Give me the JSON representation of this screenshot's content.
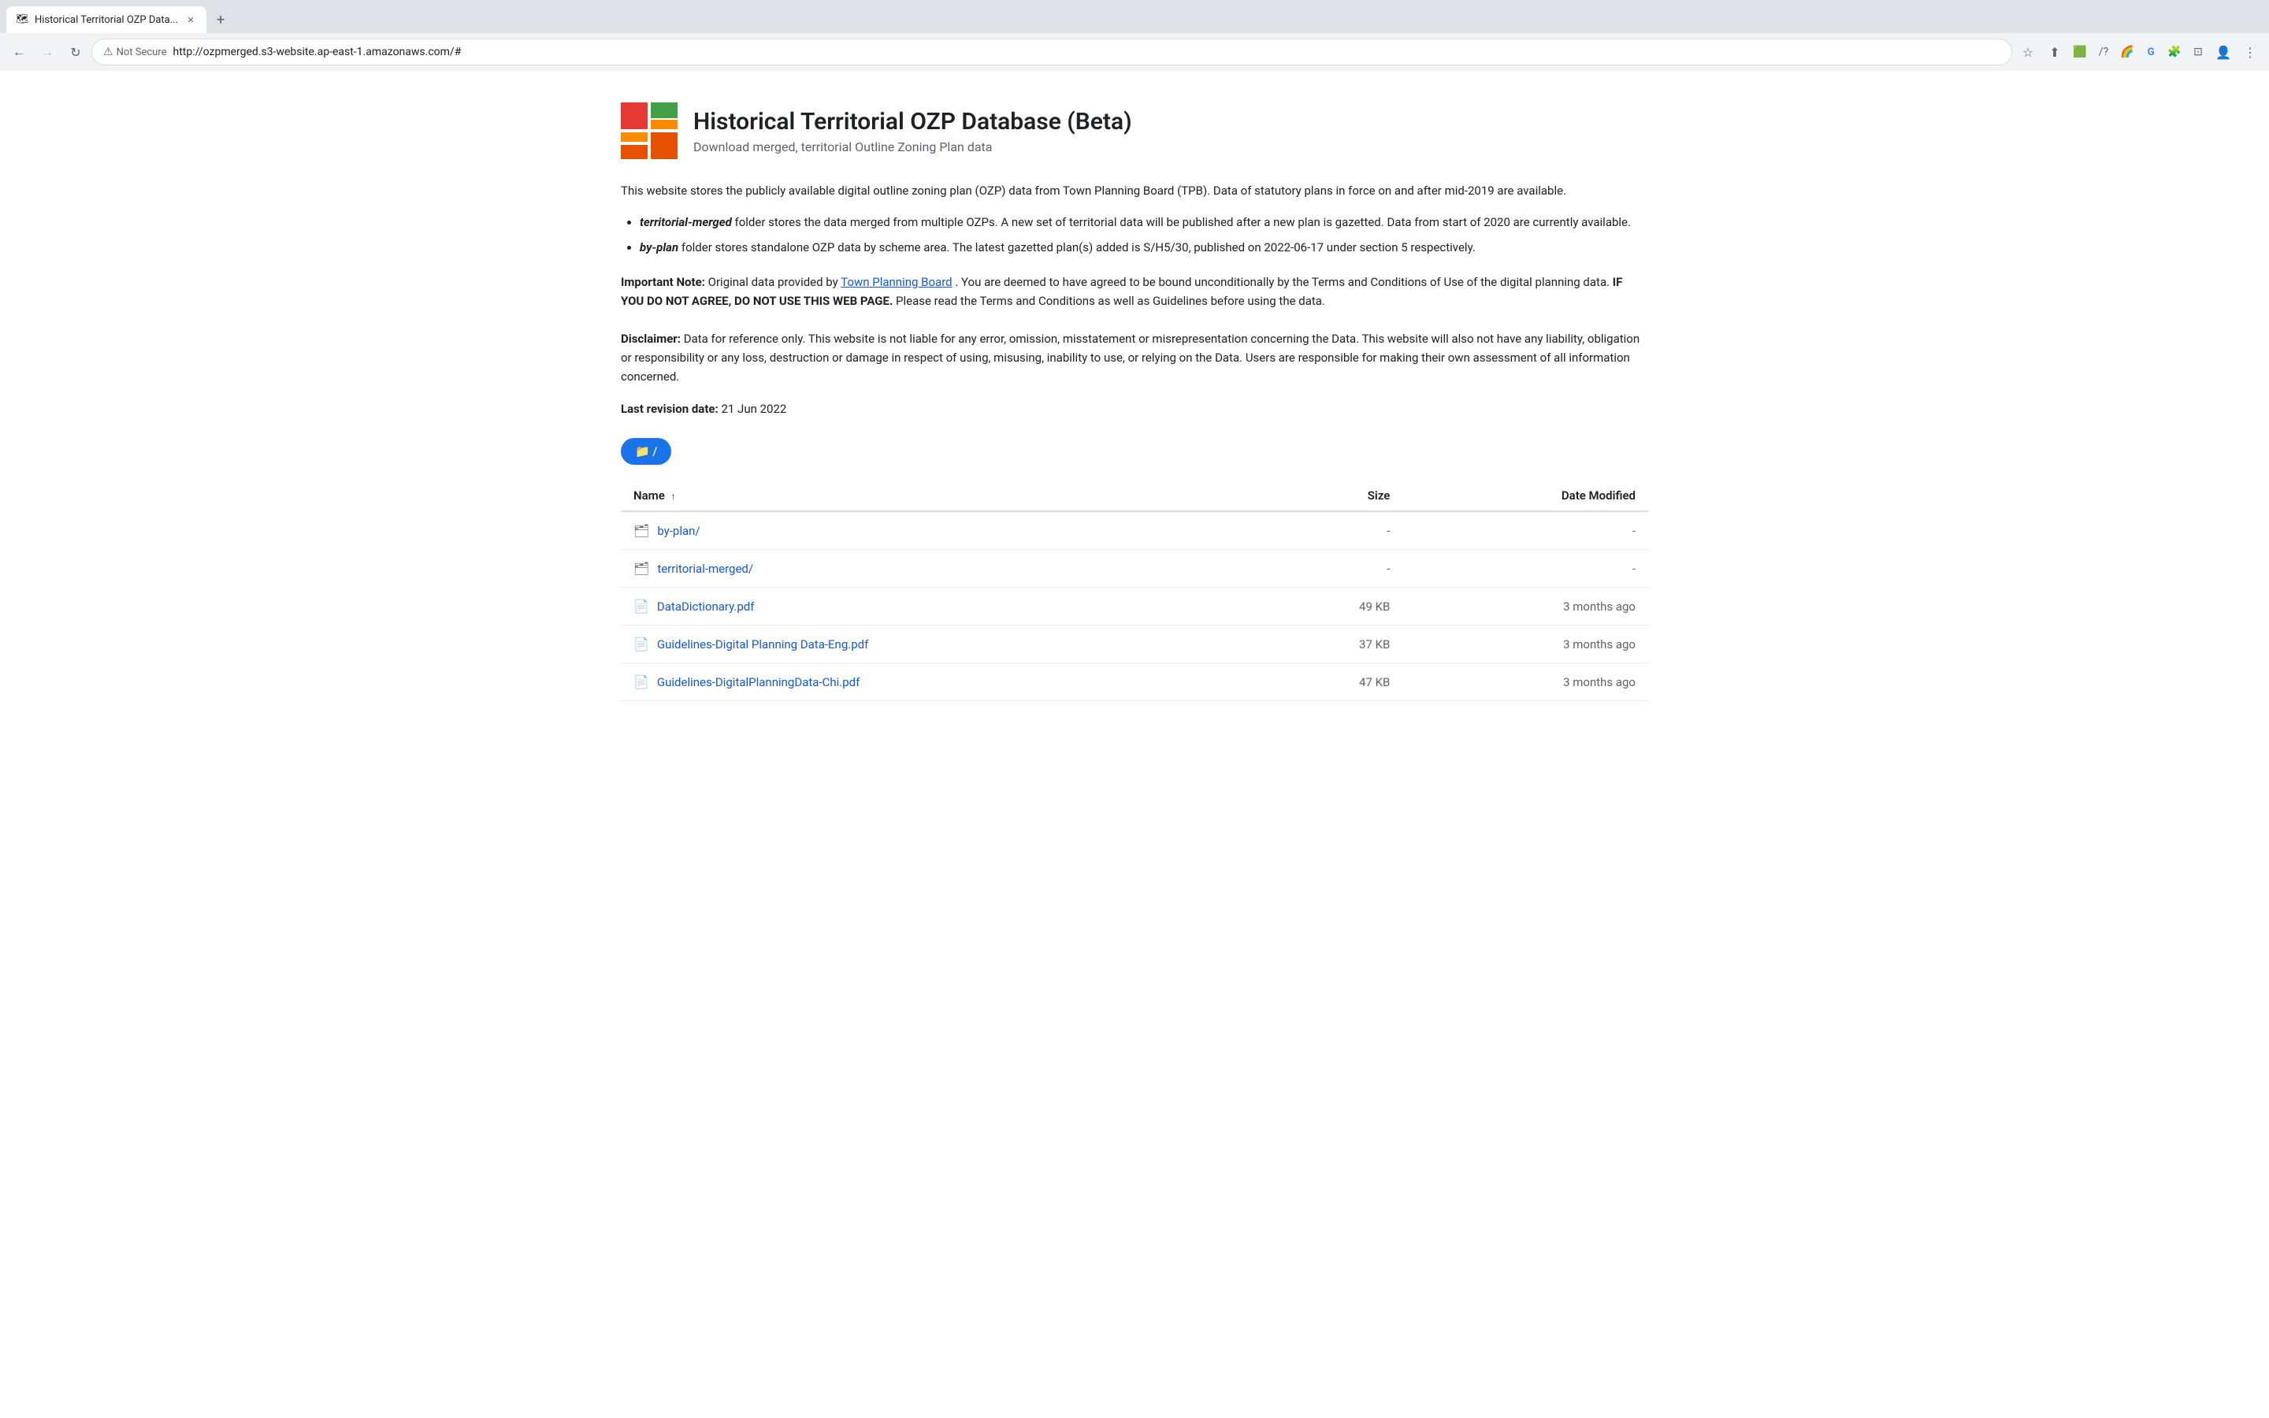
{
  "browser": {
    "tab_title": "Historical Territorial OZP Data...",
    "tab_favicon": "🗺",
    "new_tab_label": "+",
    "back_disabled": false,
    "forward_disabled": true,
    "reload_label": "↻",
    "not_secure_label": "Not Secure",
    "address_url": "http://ozpmerged.s3-website.ap-east-1.amazonaws.com/#",
    "bookmark_icon": "☆",
    "extensions": [
      "🟩",
      "/?",
      "🌈",
      "G",
      "🧩",
      "⊡"
    ],
    "profile_icon": "👤",
    "menu_icon": "⋮"
  },
  "header": {
    "title": "Historical Territorial OZP Database (Beta)",
    "subtitle": "Download merged, territorial Outline Zoning Plan data"
  },
  "description": "This website stores the publicly available digital outline zoning plan (OZP) data from Town Planning Board (TPB). Data of statutory plans in force on and after mid-2019 are available.",
  "bullets": [
    {
      "text_before_italic": "",
      "italic": "territorial-merged",
      "text_after": " folder stores the data merged from multiple OZPs. A new set of territorial data will be published after a new plan is gazetted. Data from start of 2020 are currently available."
    },
    {
      "text_before_italic": "",
      "italic": "by-plan",
      "text_after": " folder stores standalone OZP data by scheme area. The latest gazetted plan(s) added is S/H5/30, published on 2022-06-17 under section 5 respectively."
    }
  ],
  "note": {
    "important_label": "Important Note:",
    "important_text": " Original data provided by ",
    "link_text": "Town Planning Board",
    "link_url": "#",
    "important_text2": ". You are deemed to have agreed to be bound unconditionally by the Terms and Conditions of Use of the digital planning data. ",
    "strong_text": "IF YOU DO NOT AGREE, DO NOT USE THIS WEB PAGE.",
    "important_text3": " Please read the Terms and Conditions as well as Guidelines before using the data.",
    "disclaimer_label": "Disclaimer:",
    "disclaimer_text": " Data for reference only. This website is not liable for any error, omission, misstatement or misrepresentation concerning the Data. This website will also not have any liability, obligation or responsibility or any loss, destruction or damage in respect of using, misusing, inability to use, or relying on the Data. Users are responsible for making their own assessment of all information concerned."
  },
  "last_revision": {
    "label": "Last revision date:",
    "value": "21 Jun 2022"
  },
  "breadcrumb": {
    "label": "📁 /"
  },
  "table": {
    "headers": {
      "name": "Name",
      "sort_arrow": "↑",
      "size": "Size",
      "date": "Date Modified"
    },
    "rows": [
      {
        "icon": "📁",
        "icon_type": "folder",
        "name": "by-plan/",
        "size": "-",
        "date": "-"
      },
      {
        "icon": "📁",
        "icon_type": "folder",
        "name": "territorial-merged/",
        "size": "-",
        "date": "-"
      },
      {
        "icon": "📄",
        "icon_type": "file",
        "name": "DataDictionary.pdf",
        "size": "49 KB",
        "date": "3 months ago"
      },
      {
        "icon": "📄",
        "icon_type": "file",
        "name": "Guidelines-Digital Planning Data-Eng.pdf",
        "size": "37 KB",
        "date": "3 months ago"
      },
      {
        "icon": "📄",
        "icon_type": "file",
        "name": "Guidelines-DigitalPlanningData-Chi.pdf",
        "size": "47 KB",
        "date": "3 months ago"
      }
    ]
  }
}
